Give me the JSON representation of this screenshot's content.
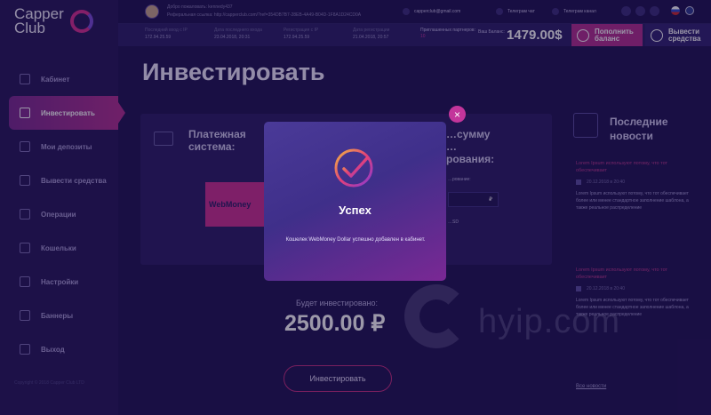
{
  "app": {
    "logo_line1": "Capper",
    "logo_line2": "Club"
  },
  "sidebar": {
    "items": [
      {
        "label": "Кабинет",
        "icon": "cabinet-icon"
      },
      {
        "label": "Инвестировать",
        "icon": "invest-icon",
        "active": true
      },
      {
        "label": "Мои депозиты",
        "icon": "deposits-icon"
      },
      {
        "label": "Вывести средства",
        "icon": "withdraw-icon"
      },
      {
        "label": "Операции",
        "icon": "operations-icon"
      },
      {
        "label": "Кошельки",
        "icon": "wallets-icon"
      },
      {
        "label": "Настройки",
        "icon": "settings-icon"
      },
      {
        "label": "Баннеры",
        "icon": "banners-icon"
      },
      {
        "label": "Выход",
        "icon": "exit-icon"
      }
    ],
    "copyright": "Copyright © 2018 Capper Club LTD"
  },
  "topbar": {
    "welcome": "Добро пожаловать: kennedy437",
    "ref_link": "Реферальная ссылка: http://capperclub.com/?ref=354DB7B7-28EB-4A49-B04D-1F8A1D24CD0A",
    "email": "capperclub@gmail.com",
    "chat": "Телеграм чат",
    "channel": "Телеграм канал"
  },
  "stats": [
    {
      "label": "Последний вход с IP",
      "value": "172.94.25.59"
    },
    {
      "label": "Дата последнего входа",
      "value": "23.04.2018, 20:31"
    },
    {
      "label": "Регистрация с IP",
      "value": "172.94.25.59"
    },
    {
      "label": "Дата регистрации",
      "value": "21.04.2018, 20:57"
    }
  ],
  "partners": {
    "label": "Приглашенных партнеров:",
    "value": "10"
  },
  "balance": {
    "label": "Ваш Баланс:",
    "value": "1479.00$"
  },
  "buttons": {
    "deposit": "Пополнить баланс",
    "withdraw": "Вывести средства"
  },
  "main": {
    "title": "Инвестировать",
    "payment_title": "Платежная система:",
    "amount_title": "…сумму …рования:",
    "wallet_name": "WebMoney",
    "invest_label": "…рование:",
    "currency_symbol": "₽",
    "invest_sm": "…SD",
    "will_invest_label": "Будет инвестировано:",
    "will_invest_value": "2500.00 ₽",
    "invest_button": "Инвестировать"
  },
  "news": {
    "title": "Последние новости",
    "items": [
      {
        "title": "Lorem Ipsum используют потому, что тот обеспечивает",
        "date": "20.12.2018 в 20:40",
        "text": "Lorem Ipsum используют потому, что тот обеспечивает более или менее стандартное заполнение шаблона, а также реальное распределение"
      },
      {
        "title": "Lorem Ipsum используют потому, что тот обеспечивает",
        "date": "20.12.2018 в 20:40",
        "text": "Lorem Ipsum используют потому, что тот обеспечивает более или менее стандартное заполнение шаблона, а также реальное распределение"
      }
    ],
    "all": "Все новости"
  },
  "watermark": "hyip.com",
  "modal": {
    "close": "×",
    "title": "Успех",
    "message": "Кошелек WebMoney Dollar успешно добавлен в кабинет."
  },
  "colors": {
    "accent": "#c3359b",
    "background": "#1e1352",
    "sidebar": "#251859",
    "active_menu": "#b0308f"
  }
}
